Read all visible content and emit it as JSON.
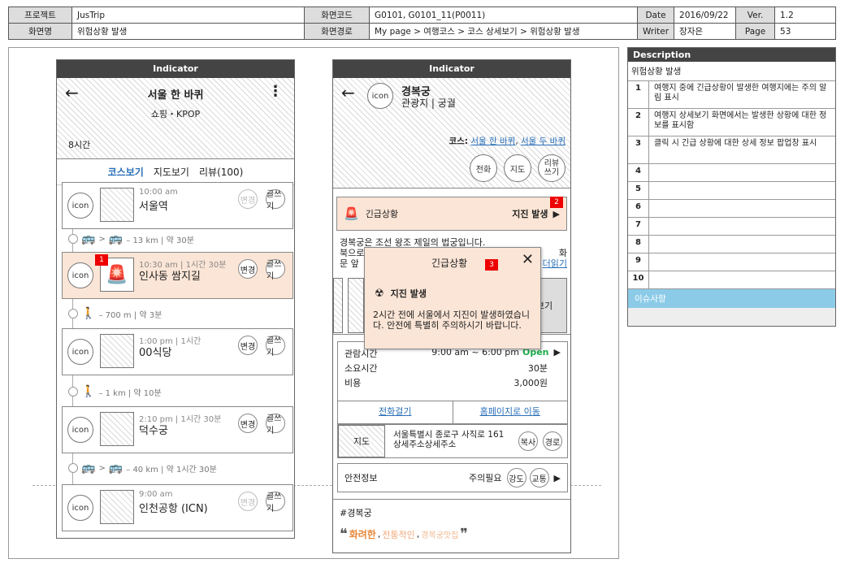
{
  "header": {
    "project_label": "프로젝트",
    "project": "JusTrip",
    "code_label": "화면코드",
    "code": "G0101, G0101_11(P0011)",
    "date_label": "Date",
    "date": "2016/09/22",
    "ver_label": "Ver.",
    "ver": "1.2",
    "screen_label": "화면명",
    "screen": "위험상황 발생",
    "path_label": "화면경로",
    "path": "My page > 여행코스 > 코스 상세보기 > 위험상황 발생",
    "writer_label": "Writer",
    "writer": "장자은",
    "page_label": "Page",
    "page": "53"
  },
  "left": {
    "indicator": "Indicator",
    "title": "서울 한 바퀴",
    "subtitle": "쇼핑・KPOP",
    "duration": "8시간",
    "tabs": [
      "코스보기",
      "지도보기",
      "리뷰(100)"
    ],
    "icon_text": "icon",
    "btn_change": "변경",
    "btn_write": "글쓰기",
    "items": [
      {
        "time": "10:00 am",
        "name": "서울역"
      },
      {
        "time": "10:30 am | 1시간 30분",
        "name": "인사동 쌈지길"
      },
      {
        "time": "1:00 pm | 1시간",
        "name": "00식당"
      },
      {
        "time": "2:10 pm | 1시간 30분",
        "name": "덕수궁"
      },
      {
        "time": "9:00 am",
        "name": "인천공항 (ICN)"
      }
    ],
    "transits": [
      "– 13 km | 약 30분",
      "– 700 m | 약 3분",
      "– 1 km | 약 10분",
      "– 40 km | 약 1시간 30분"
    ]
  },
  "right": {
    "indicator": "Indicator",
    "icon_text": "icon",
    "title": "경복궁",
    "subtitle": "관광지 | 궁궐",
    "course_label": "코스:",
    "course1": "서울 한 바퀴",
    "course2": "서울 두 바퀴",
    "btn_call": "전화",
    "btn_map": "지도",
    "btn_review": "리뷰\n쓰기",
    "emergency_label": "긴급상황",
    "emergency_value": "지진 발생",
    "intro_line1": "경복궁은 조선 왕조 제일의 법궁입니다.",
    "intro_line2": "북으로",
    "intro_line2_end": "화",
    "intro_line3": "문 앞",
    "more": "더읽기",
    "gallery_tail": "보기",
    "hours_label": "관람시간",
    "hours": "9:00 am ~ 6:00 pm",
    "open": "Open",
    "stay_label": "소요시간",
    "stay": "30분",
    "cost_label": "비용",
    "cost": "3,000원",
    "call_link": "전화걸기",
    "home_link": "홈페이지로 이동",
    "map_label": "지도",
    "address1": "서울특별시 종로구 사직로 161",
    "address2": "상세주소상세주소",
    "btn_copy": "복사",
    "btn_route": "경로",
    "safety_label": "안전정보",
    "safety_value": "주의필요",
    "btn_strength": "강도",
    "btn_traffic": "교통",
    "hashtag": "#경복궁",
    "quote_open": "❝",
    "quote_close": "❞",
    "tag1": "화려한",
    "tag2": "전통적인",
    "tag3": "경복궁맛집",
    "sep": ","
  },
  "popup": {
    "title": "긴급상황",
    "heading": "지진 발생",
    "body": "2시간 전에 서울에서 지진이 발생하였습니다. 안전에 특별히 주의하시기 바랍니다."
  },
  "tags": {
    "t1": "1",
    "t2": "2",
    "t3": "3"
  },
  "description": {
    "header": "Description",
    "title": "위험상황 발생",
    "rows": [
      {
        "n": "1",
        "d": "여행지 중에 긴급상황이 발생한 여행지에는 주의 알림 표시"
      },
      {
        "n": "2",
        "d": "여행지 상세보기 화면에서는 발생한 상황에 대한 정보를 표시함"
      },
      {
        "n": "3",
        "d": "클릭 시 긴급 상황에 대한 상세 정보 팝업창 표시"
      },
      {
        "n": "4",
        "d": ""
      },
      {
        "n": "5",
        "d": ""
      },
      {
        "n": "6",
        "d": ""
      },
      {
        "n": "7",
        "d": ""
      },
      {
        "n": "8",
        "d": ""
      },
      {
        "n": "9",
        "d": ""
      },
      {
        "n": "10",
        "d": ""
      }
    ],
    "issue": "이슈사항"
  },
  "colors": {
    "accent": "#2a6fb8",
    "highlight": "#fbe5d6",
    "tag_red": "#e00000",
    "open_green": "#1aaa4a",
    "tag_orange": "#e8873a"
  }
}
